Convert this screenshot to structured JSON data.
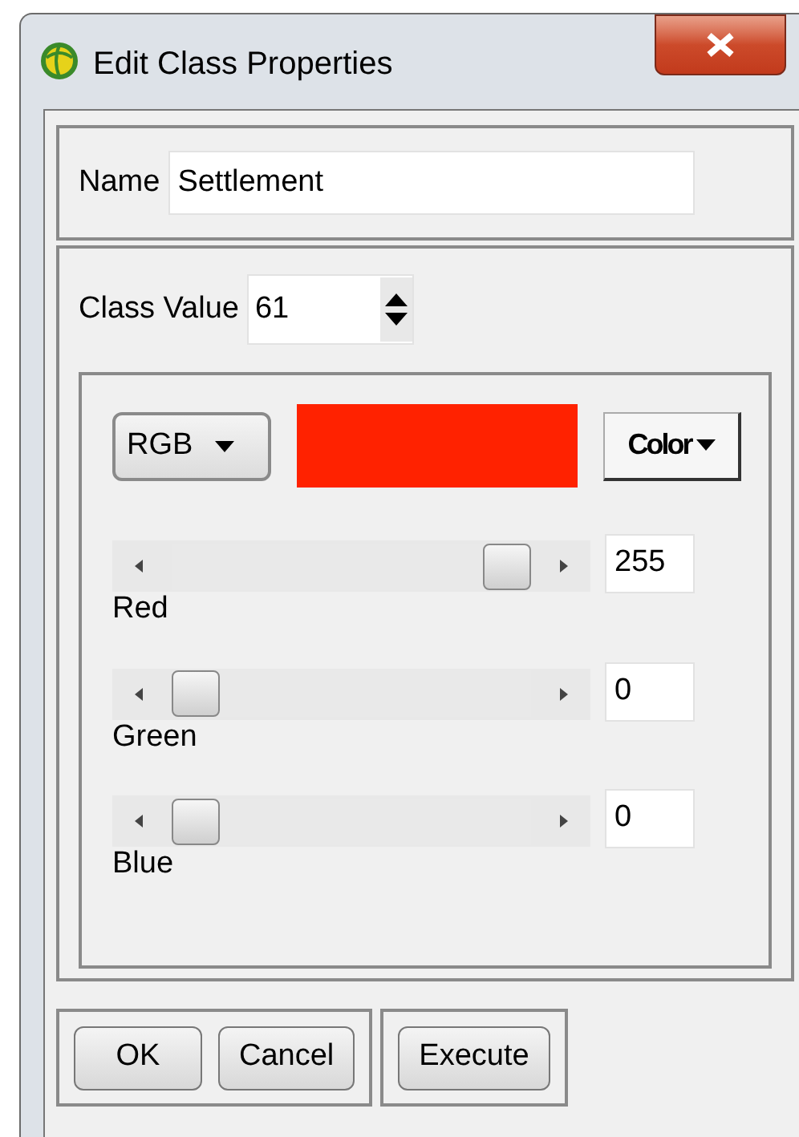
{
  "window": {
    "title": "Edit Class Properties"
  },
  "name_field": {
    "label": "Name",
    "value": "Settlement"
  },
  "class_value": {
    "label": "Class Value",
    "value": "61"
  },
  "color_model": {
    "value": "RGB"
  },
  "preview": {
    "color": "#ff2200"
  },
  "color_button": {
    "label": "Color"
  },
  "channels": [
    {
      "name": "Red",
      "level": 1,
      "value": "255"
    },
    {
      "name": "Green",
      "level": 0,
      "value": "0"
    },
    {
      "name": "Blue",
      "level": 0,
      "value": "0"
    }
  ],
  "button_groups": [
    {
      "buttons": [
        "OK",
        "Cancel"
      ]
    },
    {
      "buttons": [
        "Execute"
      ]
    }
  ]
}
